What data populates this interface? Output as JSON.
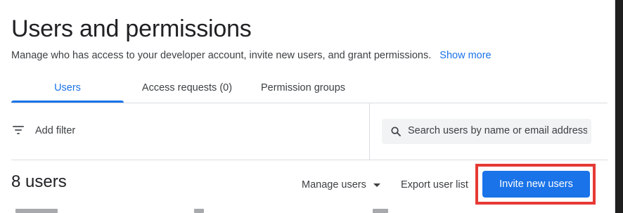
{
  "header": {
    "title": "Users and permissions",
    "subtitle": "Manage who has access to your developer account, invite new users, and grant permissions.",
    "show_more": "Show more"
  },
  "tabs": [
    {
      "label": "Users",
      "active": true
    },
    {
      "label": "Access requests (0)",
      "active": false
    },
    {
      "label": "Permission groups",
      "active": false
    }
  ],
  "filter": {
    "add_filter_label": "Add filter",
    "icon": "filter-list-icon"
  },
  "search": {
    "placeholder": "Search users by name or email address",
    "icon": "search-icon"
  },
  "users": {
    "count_label": "8 users",
    "manage_label": "Manage users",
    "export_label": "Export user list",
    "invite_label": "Invite new users"
  },
  "colors": {
    "accent": "#1a73e8",
    "highlight": "#e53935",
    "text": "#202124",
    "muted": "#3c4043"
  }
}
